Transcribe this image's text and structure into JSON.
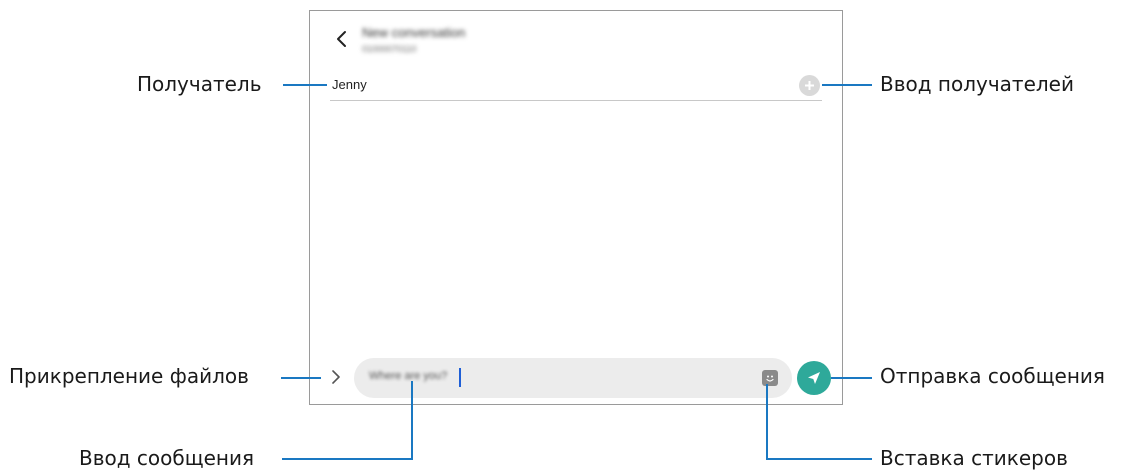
{
  "screen": {
    "header": {
      "title": "New conversation",
      "subtitle": "01000070110"
    },
    "recipient": {
      "name": "Jenny"
    },
    "composer": {
      "text": "Where are you?"
    }
  },
  "callouts": {
    "recipient": "Получатель",
    "add_recipients": "Ввод получателей",
    "attach_files": "Прикрепление файлов",
    "send_message": "Отправка сообщения",
    "enter_message": "Ввод сообщения",
    "insert_stickers": "Вставка стикеров"
  },
  "colors": {
    "accent_send": "#2ea99a",
    "leader_line": "#1a78c2",
    "caret": "#1f5fd6"
  },
  "icons": {
    "back": "chevron-left-icon",
    "add": "plus-circle-icon",
    "attach": "chevron-right-icon",
    "sticker": "sticker-icon",
    "send": "paper-plane-icon"
  }
}
